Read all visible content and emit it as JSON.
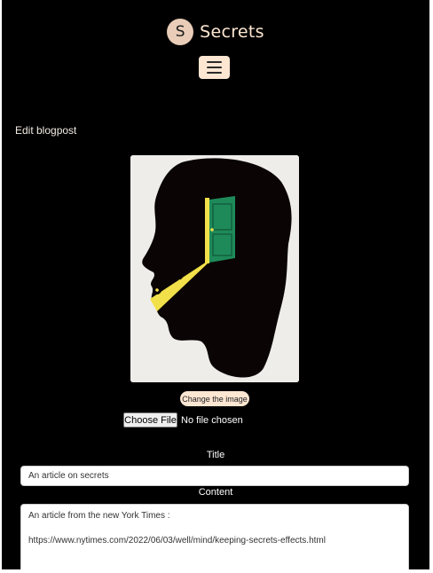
{
  "header": {
    "logo_letter": "S",
    "site_name": "Secrets"
  },
  "page": {
    "heading": "Edit blogpost"
  },
  "image_section": {
    "icon": "head-with-door-and-key-illustration",
    "change_button_label": "Change the image",
    "choose_file_label": "Choose File",
    "file_status": "No file chosen"
  },
  "form": {
    "title_label": "Title",
    "title_value": "An article on secrets",
    "content_label": "Content",
    "content_line1": "An article from the new York Times :",
    "content_line2": "https://www.nytimes.com/2022/06/03/well/mind/keeping-secrets-effects.html"
  },
  "colors": {
    "background": "#000000",
    "accent": "#fde6d2",
    "logo_bg": "#e9cdb8",
    "door_green": "#1e8a5a",
    "key_yellow": "#f2e04a"
  }
}
